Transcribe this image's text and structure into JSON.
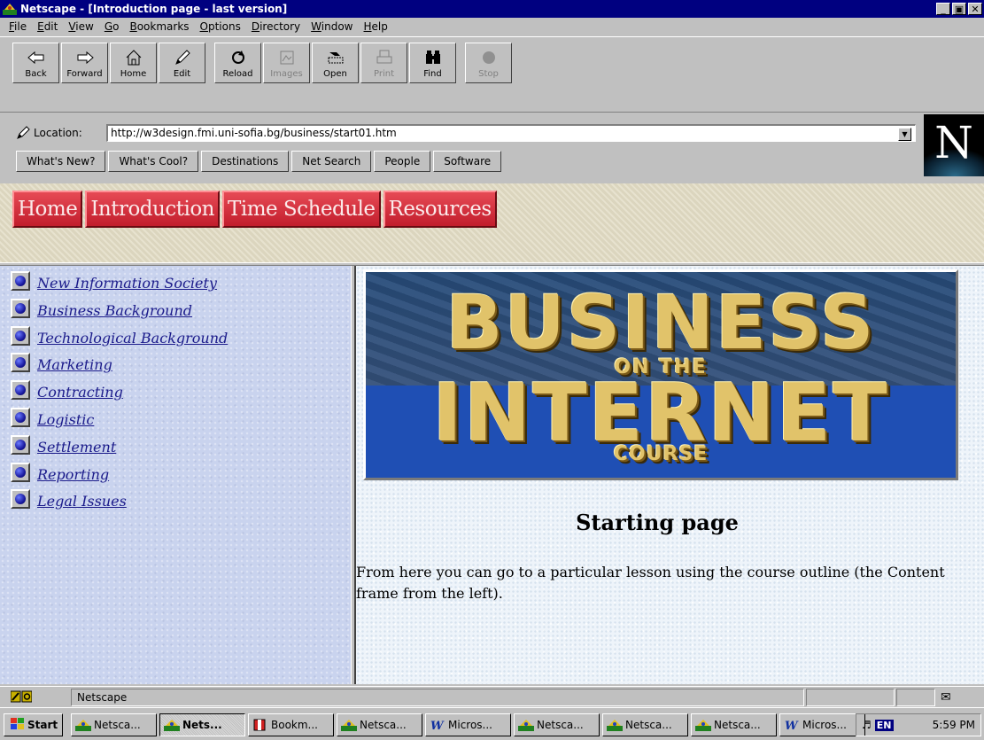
{
  "window": {
    "title": "Netscape - [Introduction page - last version]"
  },
  "menu": [
    "File",
    "Edit",
    "View",
    "Go",
    "Bookmarks",
    "Options",
    "Directory",
    "Window",
    "Help"
  ],
  "menu_mnemonics": [
    "F",
    "E",
    "V",
    "G",
    "B",
    "O",
    "D",
    "W",
    "H"
  ],
  "toolbar": {
    "buttons": [
      {
        "label": "Back",
        "icon": "back-arrow-icon",
        "enabled": true
      },
      {
        "label": "Forward",
        "icon": "forward-arrow-icon",
        "enabled": true
      },
      {
        "label": "Home",
        "icon": "home-icon",
        "enabled": true
      },
      {
        "label": "Edit",
        "icon": "pencil-icon",
        "enabled": true
      },
      {
        "label": "Reload",
        "icon": "reload-icon",
        "enabled": true
      },
      {
        "label": "Images",
        "icon": "images-icon",
        "enabled": false
      },
      {
        "label": "Open",
        "icon": "open-icon",
        "enabled": true
      },
      {
        "label": "Print",
        "icon": "print-icon",
        "enabled": false
      },
      {
        "label": "Find",
        "icon": "binoculars-icon",
        "enabled": true
      },
      {
        "label": "Stop",
        "icon": "stop-icon",
        "enabled": false
      }
    ]
  },
  "location": {
    "label": "Location:",
    "url": "http://w3design.fmi.uni-sofia.bg/business/start01.htm"
  },
  "directory_buttons": [
    "What's New?",
    "What's Cool?",
    "Destinations",
    "Net Search",
    "People",
    "Software"
  ],
  "logo": {
    "letter": "N"
  },
  "top_nav": [
    "Home",
    "Introduction",
    "Time Schedule",
    "Resources"
  ],
  "outline": [
    "New Information Society",
    "Business Background",
    "Technological Background",
    "Marketing",
    "Contracting",
    "Logistic",
    "Settlement",
    "Reporting",
    "Legal Issues"
  ],
  "banner": {
    "line1": "BUSINESS",
    "line2": "ON THE",
    "line3": "INTERNET",
    "line4": "COURSE"
  },
  "content": {
    "heading": "Starting page",
    "paragraph": "From here you can go to a particular lesson using the course outline (the Content frame from the left)."
  },
  "status": {
    "text": "Netscape"
  },
  "taskbar": {
    "start": "Start",
    "tasks": [
      {
        "label": "Netsca...",
        "icon": "netscape-icon",
        "active": false
      },
      {
        "label": "Nets...",
        "icon": "netscape-icon",
        "active": true
      },
      {
        "label": "Bookm...",
        "icon": "bookmark-icon",
        "active": false
      },
      {
        "label": "Netsca...",
        "icon": "netscape-icon",
        "active": false
      },
      {
        "label": "Micros...",
        "icon": "word-icon",
        "active": false
      },
      {
        "label": "Netsca...",
        "icon": "netscape-icon",
        "active": false
      },
      {
        "label": "Netsca...",
        "icon": "netscape-icon",
        "active": false
      },
      {
        "label": "Netsca...",
        "icon": "netscape-icon",
        "active": false
      },
      {
        "label": "Micros...",
        "icon": "word-icon",
        "active": false
      }
    ],
    "lang": "EN",
    "clock": "5:59 PM"
  },
  "colors": {
    "titlebar": "#000080",
    "nav_button": "#d0303c",
    "banner_gold": "#e1c36a",
    "banner_blue": "#1f4fb4",
    "link": "#1a1a8a"
  }
}
